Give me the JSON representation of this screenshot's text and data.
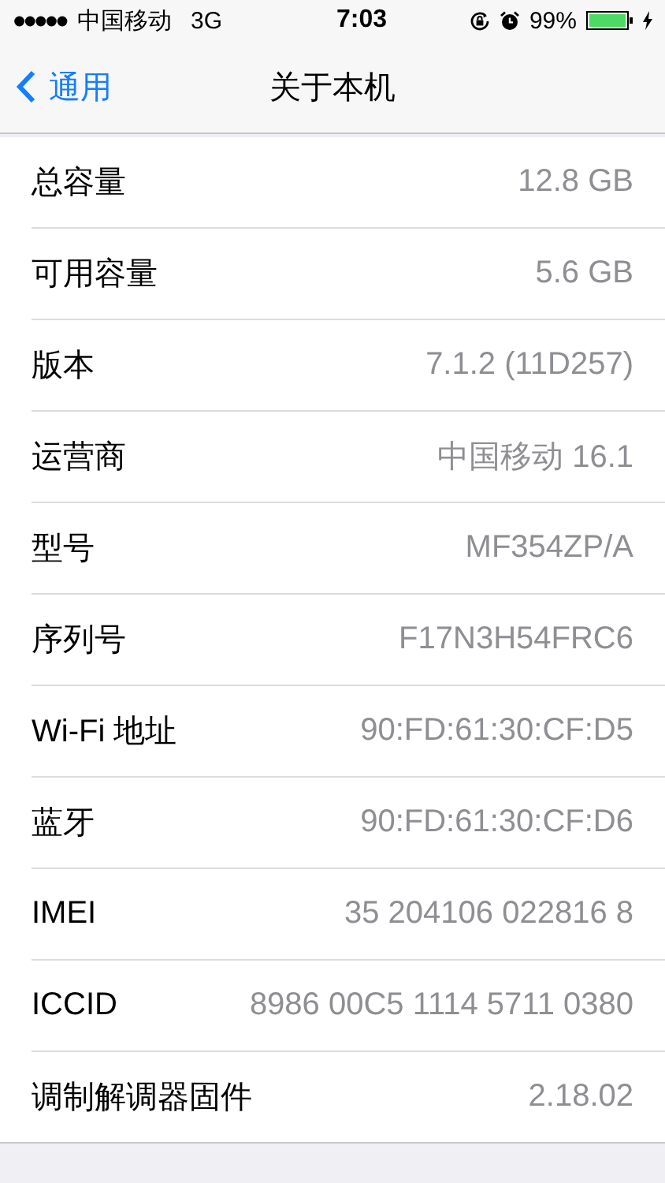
{
  "status_bar": {
    "carrier": "中国移动",
    "network": "3G",
    "time": "7:03",
    "battery_percent": "99%",
    "charging": true
  },
  "nav_bar": {
    "back_label": "通用",
    "title": "关于本机"
  },
  "rows": [
    {
      "label": "总容量",
      "value": "12.8 GB"
    },
    {
      "label": "可用容量",
      "value": "5.6 GB"
    },
    {
      "label": "版本",
      "value": "7.1.2 (11D257)"
    },
    {
      "label": "运营商",
      "value": "中国移动 16.1"
    },
    {
      "label": "型号",
      "value": "MF354ZP/A"
    },
    {
      "label": "序列号",
      "value": "F17N3H54FRC6"
    },
    {
      "label": "Wi-Fi 地址",
      "value": "90:FD:61:30:CF:D5"
    },
    {
      "label": "蓝牙",
      "value": "90:FD:61:30:CF:D6"
    },
    {
      "label": "IMEI",
      "value": "35 204106 022816 8"
    },
    {
      "label": "ICCID",
      "value": "8986 00C5 1114 5711 0380"
    },
    {
      "label": "调制解调器固件",
      "value": "2.18.02"
    }
  ]
}
